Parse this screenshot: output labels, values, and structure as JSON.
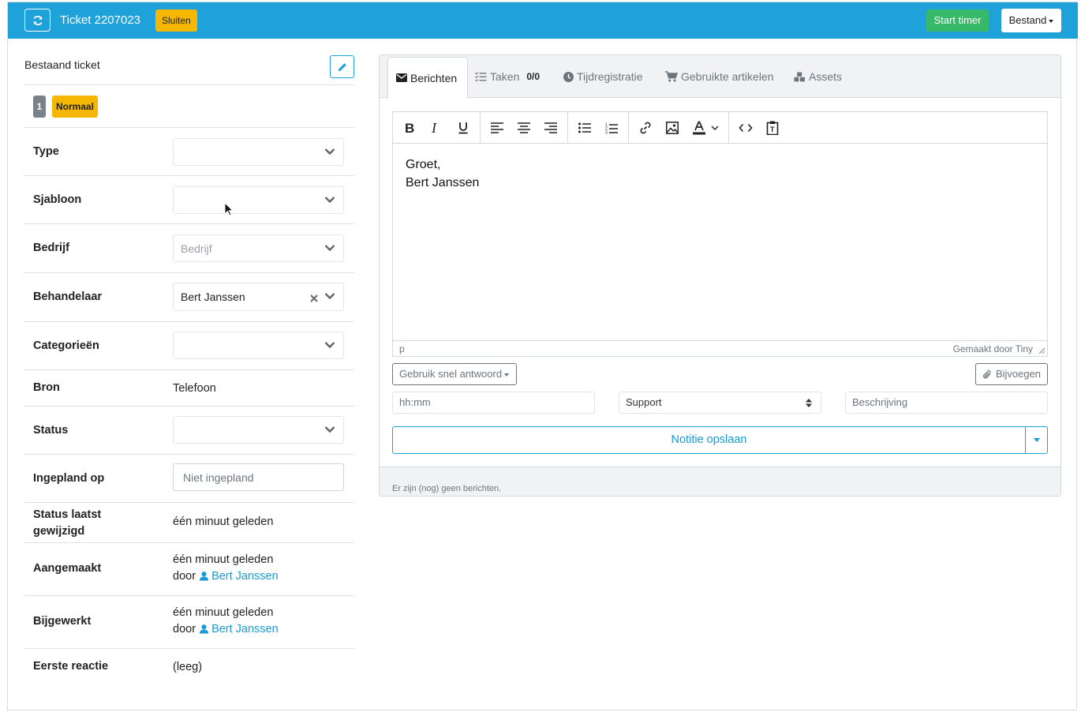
{
  "header": {
    "title": "Ticket 2207023",
    "close_label": "Sluiten",
    "start_timer_label": "Start timer",
    "file_menu_label": "Bestand",
    "accent_color": "#1fa1d9"
  },
  "left_panel": {
    "heading": "Bestaand ticket",
    "priority_number": "1",
    "priority_label": "Normaal",
    "fields": {
      "type": {
        "label": "Type",
        "value": ""
      },
      "template": {
        "label": "Sjabloon",
        "value": ""
      },
      "company": {
        "label": "Bedrijf",
        "placeholder": "Bedrijf"
      },
      "handler": {
        "label": "Behandelaar",
        "value": "Bert Janssen"
      },
      "categories": {
        "label": "Categorieën",
        "value": ""
      },
      "source": {
        "label": "Bron",
        "value": "Telefoon"
      },
      "status": {
        "label": "Status",
        "value": ""
      },
      "planned": {
        "label": "Ingepland op",
        "placeholder": "Niet ingepland"
      },
      "status_changed": {
        "label_line1": "Status laatst",
        "label_line2": "gewijzigd",
        "value": "één minuut geleden"
      },
      "created": {
        "label": "Aangemaakt",
        "when": "één minuut geleden",
        "by_prefix": "door",
        "by_user": "Bert Janssen"
      },
      "updated": {
        "label": "Bijgewerkt",
        "when": "één minuut geleden",
        "by_prefix": "door",
        "by_user": "Bert Janssen"
      },
      "first_response": {
        "label": "Eerste reactie",
        "value": "(leeg)"
      }
    }
  },
  "right_panel": {
    "tabs": [
      {
        "label": "Berichten",
        "icon": "envelope-icon",
        "active": true
      },
      {
        "label": "Taken",
        "icon": "tasks-icon",
        "count": "0/0"
      },
      {
        "label": "Tijdregistratie",
        "icon": "clock-icon"
      },
      {
        "label": "Gebruikte artikelen",
        "icon": "cart-icon"
      },
      {
        "label": "Assets",
        "icon": "cubes-icon"
      }
    ],
    "editor": {
      "line1": "Groet,",
      "line2": "Bert Janssen",
      "path": "p",
      "branding": "Gemaakt door Tiny"
    },
    "quick_reply_label": "Gebruik snel antwoord",
    "attach_label": "Bijvoegen",
    "time_placeholder": "hh:mm",
    "activity_value": "Support",
    "description_placeholder": "Beschrijving",
    "save_label": "Notitie opslaan",
    "empty_message": "Er zijn (nog) geen berichten."
  }
}
